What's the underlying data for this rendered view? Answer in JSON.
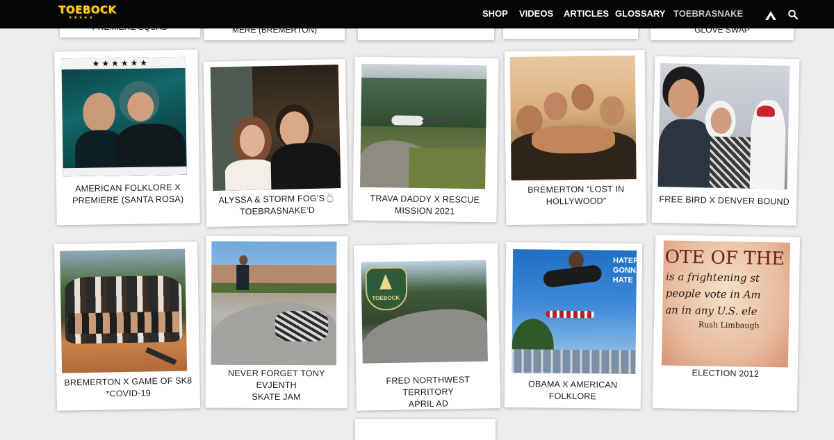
{
  "site": {
    "logo_text": "TOEBOCK",
    "logo_stars": "★★★★★"
  },
  "nav": [
    {
      "label": "SHOP",
      "muted": false
    },
    {
      "label": "VIDEOS",
      "muted": false
    },
    {
      "label": "ARTICLES",
      "muted": false
    },
    {
      "label": "GLOSSARY",
      "muted": false
    },
    {
      "label": "TOEBRASNAKE",
      "muted": true
    }
  ],
  "icons": {
    "logo_mark": "mountain-icon",
    "search": "search-icon"
  },
  "partial_row": [
    {
      "caption": "PREMIERE SQUAD"
    },
    {
      "caption": "MERE (BREMERTON)"
    },
    {
      "caption": ""
    },
    {
      "caption": ""
    },
    {
      "caption": "GLOVE SWAP"
    }
  ],
  "posts": [
    {
      "caption_lines": [
        "AMERICAN FOLKLORE X",
        "PREMIERE (SANTA ROSA)"
      ],
      "photo_stars": "★★★★★★"
    },
    {
      "caption_lines": [
        "ALYSSA & STORM FOG’S💍",
        "TOEBRASNAKE’D"
      ]
    },
    {
      "caption_lines": [
        "TRAVA DADDY X RESCUE",
        "MISSION 2021"
      ]
    },
    {
      "caption_lines": [
        "BREMERTON “LOST IN",
        "HOLLYWOOD”"
      ]
    },
    {
      "caption_lines": [
        "FREE BIRD X DENVER BOUND"
      ]
    },
    {
      "caption_lines": [
        "BREMERTON X GAME OF SK8",
        "*COVID-19"
      ]
    },
    {
      "caption_lines": [
        "NEVER FORGET TONY EVJENTH",
        "SKATE JAM"
      ]
    },
    {
      "caption_lines": [
        "FRED NORTHWEST TERRITORY",
        "APRIL AD"
      ],
      "badge_text": "TOEBOCK"
    },
    {
      "caption_lines": [
        "OBAMA X AMERICAN FOLKLORE"
      ],
      "photo_text_lines": [
        "HATERS",
        "GONNA",
        "HATE"
      ]
    },
    {
      "caption_lines": [
        "ELECTION 2012"
      ],
      "photo_text_lines": [
        "OTE OF THE",
        "is a frightening st",
        "people vote in Am",
        "an in any U.S. ele",
        "Rush Limbaugh"
      ]
    }
  ]
}
